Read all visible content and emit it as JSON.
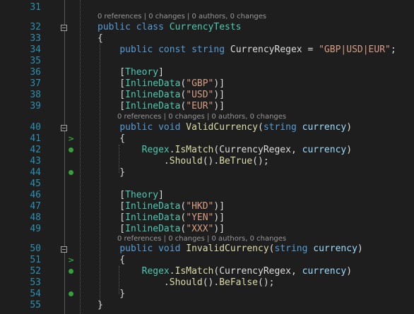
{
  "lines": [
    {
      "no": "31",
      "text": ""
    },
    {
      "no": "32",
      "text": "public class CurrencyTests"
    },
    {
      "no": "33",
      "text": "{"
    },
    {
      "no": "34",
      "text": "    public const string CurrencyRegex = \"GBP|USD|EUR\";"
    },
    {
      "no": "35",
      "text": ""
    },
    {
      "no": "36",
      "text": "    [Theory]"
    },
    {
      "no": "37",
      "text": "    [InlineData(\"GBP\")]"
    },
    {
      "no": "38",
      "text": "    [InlineData(\"USD\")]"
    },
    {
      "no": "39",
      "text": "    [InlineData(\"EUR\")]"
    },
    {
      "no": "40",
      "text": "    public void ValidCurrency(string currency)"
    },
    {
      "no": "41",
      "text": "    {"
    },
    {
      "no": "42",
      "text": "        Regex.IsMatch(CurrencyRegex, currency)"
    },
    {
      "no": "43",
      "text": "            .Should().BeTrue();"
    },
    {
      "no": "44",
      "text": "    }"
    },
    {
      "no": "45",
      "text": ""
    },
    {
      "no": "46",
      "text": "    [Theory]"
    },
    {
      "no": "47",
      "text": "    [InlineData(\"HKD\")]"
    },
    {
      "no": "48",
      "text": "    [InlineData(\"YEN\")]"
    },
    {
      "no": "49",
      "text": "    [InlineData(\"XXX\")]"
    },
    {
      "no": "50",
      "text": "    public void InvalidCurrency(string currency)"
    },
    {
      "no": "51",
      "text": "    {"
    },
    {
      "no": "52",
      "text": "        Regex.IsMatch(CurrencyRegex, currency)"
    },
    {
      "no": "53",
      "text": "            .Should().BeFalse();"
    },
    {
      "no": "54",
      "text": "    }"
    },
    {
      "no": "55",
      "text": "}"
    }
  ],
  "codelens": {
    "class": "0 references | 0 changes | 0 authors, 0 changes",
    "valid": "0 references | 0 changes | 0 authors, 0 changes",
    "invalid": "0 references | 0 changes | 0 authors, 0 changes"
  },
  "colors": {
    "keyword": "#569cd6",
    "type": "#4ec9b0",
    "string": "#d69d85",
    "method": "#dcdcaa",
    "line_number": "#2b91af",
    "test_pass": "#37a13e"
  },
  "icons": [
    "collapse-icon",
    "run-test-icon",
    "test-passed-icon"
  ]
}
